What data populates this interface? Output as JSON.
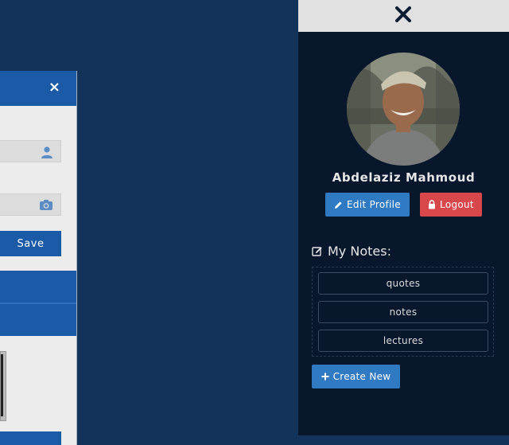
{
  "modal": {
    "close_label": "×",
    "save_label": "Save",
    "icons": {
      "username_field": "user-icon",
      "avatar_field": "camera-icon",
      "close": "close-icon"
    }
  },
  "sidebar": {
    "close_icon": "close-icon",
    "user_name": "Abdelaziz Mahmoud",
    "edit_profile_label": "Edit Profile",
    "logout_label": "Logout",
    "notes_heading": "My Notes:",
    "notes": [
      {
        "label": "quotes"
      },
      {
        "label": "notes"
      },
      {
        "label": "lectures"
      }
    ],
    "create_new_label": "Create New"
  },
  "colors": {
    "page_background": "#13335a",
    "sidebar_background": "#08172c",
    "primary": "#2f7ac3",
    "danger": "#d8484a",
    "modal_header": "#1a5aa6"
  }
}
